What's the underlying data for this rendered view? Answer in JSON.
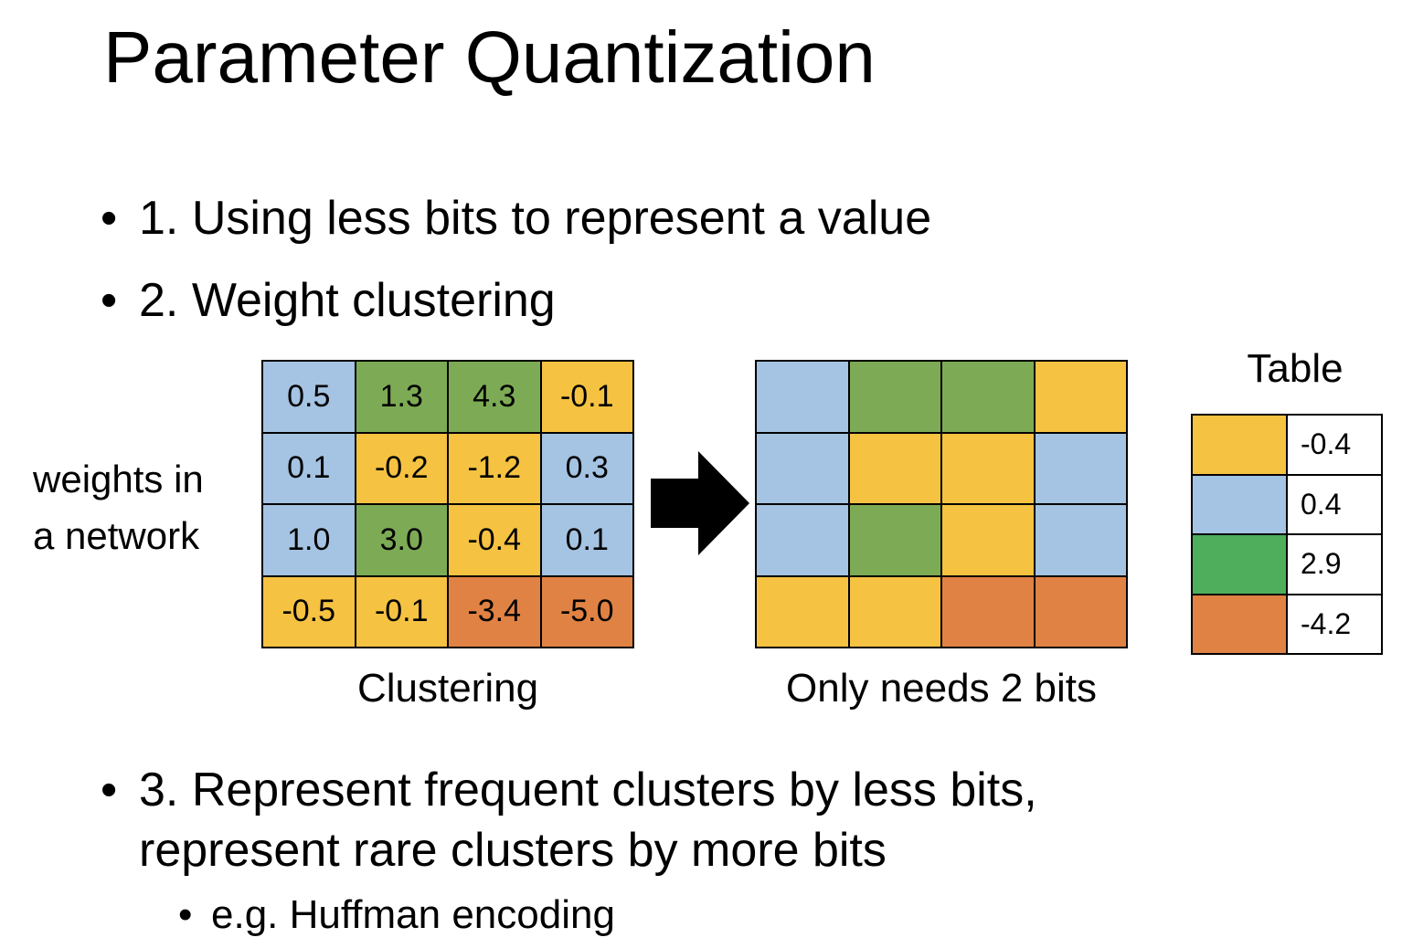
{
  "title": "Parameter Quantization",
  "bullets": [
    {
      "marker": "•",
      "text": "1. Using less bits to represent a value"
    },
    {
      "marker": "•",
      "text": "2. Weight clustering"
    },
    {
      "marker": "•",
      "text_line1": "3. Represent frequent clusters by less bits,",
      "text_line2": "represent rare clusters by more bits"
    }
  ],
  "sub_bullet": {
    "marker": "•",
    "text": "e.g. Huffman encoding"
  },
  "side_label": {
    "line1": "weights in",
    "line2": "a network"
  },
  "colors": {
    "yellow": "#F5C242",
    "blue": "#A5C3E2",
    "green": "#7DAB55",
    "orange": "#E08244",
    "table_green": "#4EAE5B"
  },
  "weights": [
    {
      "value": "0.5",
      "color": "#A5C3E2"
    },
    {
      "value": "1.3",
      "color": "#7DAB55"
    },
    {
      "value": "4.3",
      "color": "#7DAB55"
    },
    {
      "value": "-0.1",
      "color": "#F5C242"
    },
    {
      "value": "0.1",
      "color": "#A5C3E2"
    },
    {
      "value": "-0.2",
      "color": "#F5C242"
    },
    {
      "value": "-1.2",
      "color": "#F5C242"
    },
    {
      "value": "0.3",
      "color": "#A5C3E2"
    },
    {
      "value": "1.0",
      "color": "#A5C3E2"
    },
    {
      "value": "3.0",
      "color": "#7DAB55"
    },
    {
      "value": "-0.4",
      "color": "#F5C242"
    },
    {
      "value": "0.1",
      "color": "#A5C3E2"
    },
    {
      "value": "-0.5",
      "color": "#F5C242"
    },
    {
      "value": "-0.1",
      "color": "#F5C242"
    },
    {
      "value": "-3.4",
      "color": "#E08244"
    },
    {
      "value": "-5.0",
      "color": "#E08244"
    }
  ],
  "captions": {
    "clustering": "Clustering",
    "bits": "Only needs 2 bits"
  },
  "table": {
    "title": "Table",
    "rows": [
      {
        "color": "#F5C242",
        "value": "-0.4"
      },
      {
        "color": "#A5C3E2",
        "value": "0.4"
      },
      {
        "color": "#4EAE5B",
        "value": "2.9"
      },
      {
        "color": "#E08244",
        "value": "-4.2"
      }
    ]
  }
}
